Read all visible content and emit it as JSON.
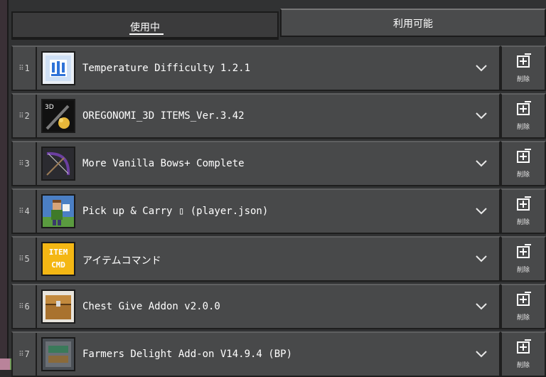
{
  "tabs": {
    "in_use": "使用中",
    "available": "利用可能"
  },
  "packs": [
    {
      "index": "1",
      "title": "Temperature Difficulty 1.2.1",
      "icon": "temperature-icon"
    },
    {
      "index": "2",
      "title": "OREGONOMI_3D ITEMS_Ver.3.42",
      "icon": "sword-icon",
      "badge": "3D"
    },
    {
      "index": "3",
      "title": "More Vanilla Bows+ Complete",
      "icon": "bow-icon"
    },
    {
      "index": "4",
      "title": "Pick up & Carry ▯ (player.json)",
      "icon": "character-icon"
    },
    {
      "index": "5",
      "title": "アイテムコマンド",
      "icon": "item-cmd-icon",
      "badge_line1": "ITEM",
      "badge_line2": "CMD"
    },
    {
      "index": "6",
      "title": "Chest Give Addon v2.0.0",
      "icon": "chest-icon"
    },
    {
      "index": "7",
      "title": "Farmers Delight Add-on V14.9.4 (BP)",
      "icon": "farm-icon"
    }
  ],
  "delete_label": "削除",
  "colors": {
    "panel": "#313233",
    "row": "#48494a",
    "border": "#1e1e1e",
    "item_cmd_yellow": "#f4b714"
  }
}
